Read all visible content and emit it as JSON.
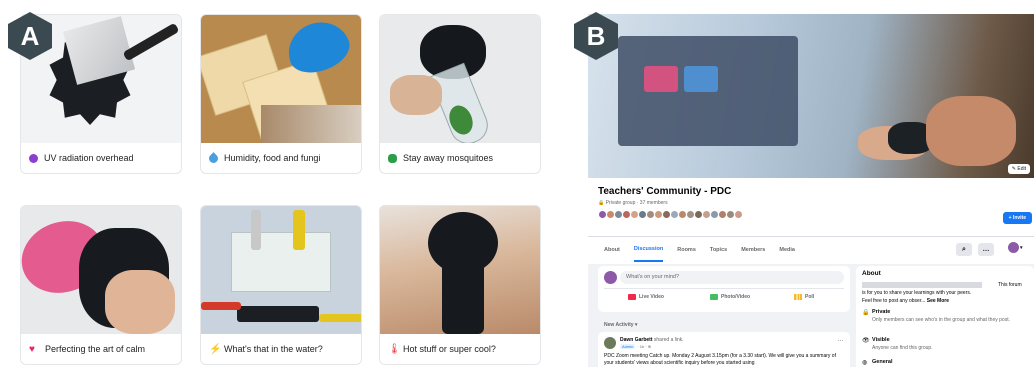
{
  "badges": {
    "a": "A",
    "b": "B"
  },
  "cards": [
    {
      "caption": "UV radiation overhead",
      "icon": "purple-circle-icon",
      "color": "#8a3fd1"
    },
    {
      "caption": "Humidity, food and fungi",
      "icon": "water-drop-icon",
      "color": "#4a9fe0"
    },
    {
      "caption": "Stay away mosquitoes",
      "icon": "green-bug-icon",
      "color": "#2e9d4a"
    },
    {
      "caption": "Perfecting the art of calm",
      "icon": "heart-icon",
      "color": "#e5275f"
    },
    {
      "caption": "What's that in the water?",
      "icon": "lightning-icon",
      "color": "#f2b41a"
    },
    {
      "caption": "Hot stuff or super cool?",
      "icon": "thermometer-icon",
      "color": "#e23a3a"
    }
  ],
  "group": {
    "edit_label": "✎ Edit",
    "title": "Teachers' Community - PDC",
    "subtitle": "🔒 Private group · 37 members",
    "invite_label": "+ Invite",
    "tabs": [
      "About",
      "Discussion",
      "Rooms",
      "Topics",
      "Members",
      "Media"
    ],
    "composer_placeholder": "What's on your mind?",
    "actions": [
      "Live Video",
      "Photo/Video",
      "Poll"
    ],
    "new_activity": "New Activity ▾",
    "post": {
      "author": "Dawn Garbett",
      "author_suffix": "shared a link.",
      "badge": "Admin",
      "time": "· 1h · ⊕",
      "text": "PDC Zoom meeting Catch up. Monday 2 August 3.15pm (for a 3.30 start). We will give you a summary of your students' views about scientific inquiry before you started using"
    },
    "about": {
      "title": "About",
      "desc_tail": "This forum",
      "desc_line2": "is for you to share your learnings with your peers.",
      "desc_line3": "Feel free to post any obser...",
      "see_more": "See More",
      "private_title": "Private",
      "private_desc": "Only members can see who's in the group and what they post.",
      "visible_title": "Visible",
      "visible_desc": "Anyone can find this group.",
      "general_title": "General"
    }
  }
}
